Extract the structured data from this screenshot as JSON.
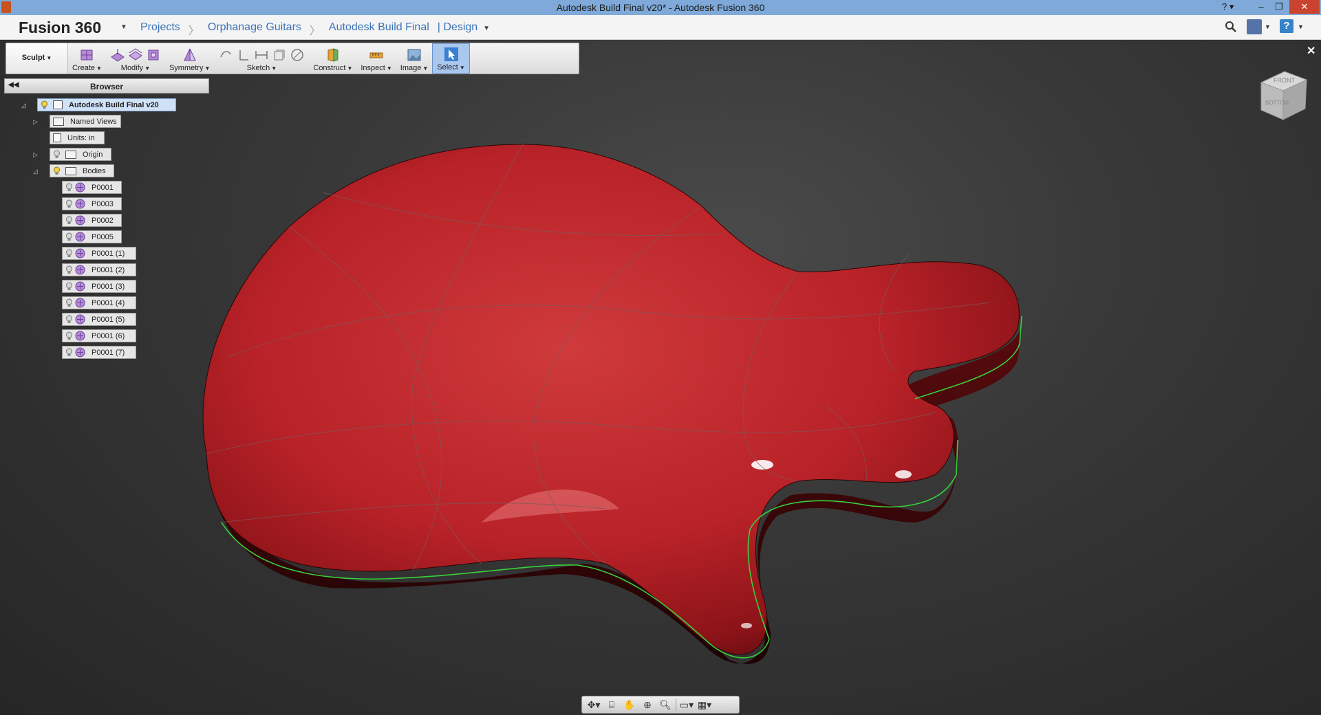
{
  "window": {
    "title": "Autodesk Build Final v20* - Autodesk Fusion 360",
    "help_label": "?",
    "minimize": "–",
    "restore": "❐",
    "close": "✕"
  },
  "app": {
    "brand": "Fusion 360",
    "breadcrumbs": [
      "Projects",
      "Orphanage Guitars",
      "Autodesk Build Final",
      "| Design"
    ],
    "help_label": "?"
  },
  "toolbar": {
    "workspace": "Sculpt",
    "groups": [
      "Create",
      "Modify",
      "Symmetry",
      "Sketch",
      "Construct",
      "Inspect",
      "Image",
      "Select"
    ],
    "active_group": "Select"
  },
  "browser": {
    "title": "Browser",
    "root": "Autodesk Build Final v20",
    "named_views": "Named Views",
    "units": "Units: in",
    "origin": "Origin",
    "bodies": "Bodies",
    "body_items": [
      "P0001",
      "P0003",
      "P0002",
      "P0005",
      "P0001 (1)",
      "P0001 (2)",
      "P0001 (3)",
      "P0001 (4)",
      "P0001 (5)",
      "P0001 (6)",
      "P0001 (7)"
    ]
  },
  "viewcube": {
    "front": "FRONT",
    "bottom": "BOTTOM"
  },
  "colors": {
    "model_red": "#c7262b",
    "edge_highlight": "#38d13a",
    "selection_blue": "#cfe1f7"
  }
}
